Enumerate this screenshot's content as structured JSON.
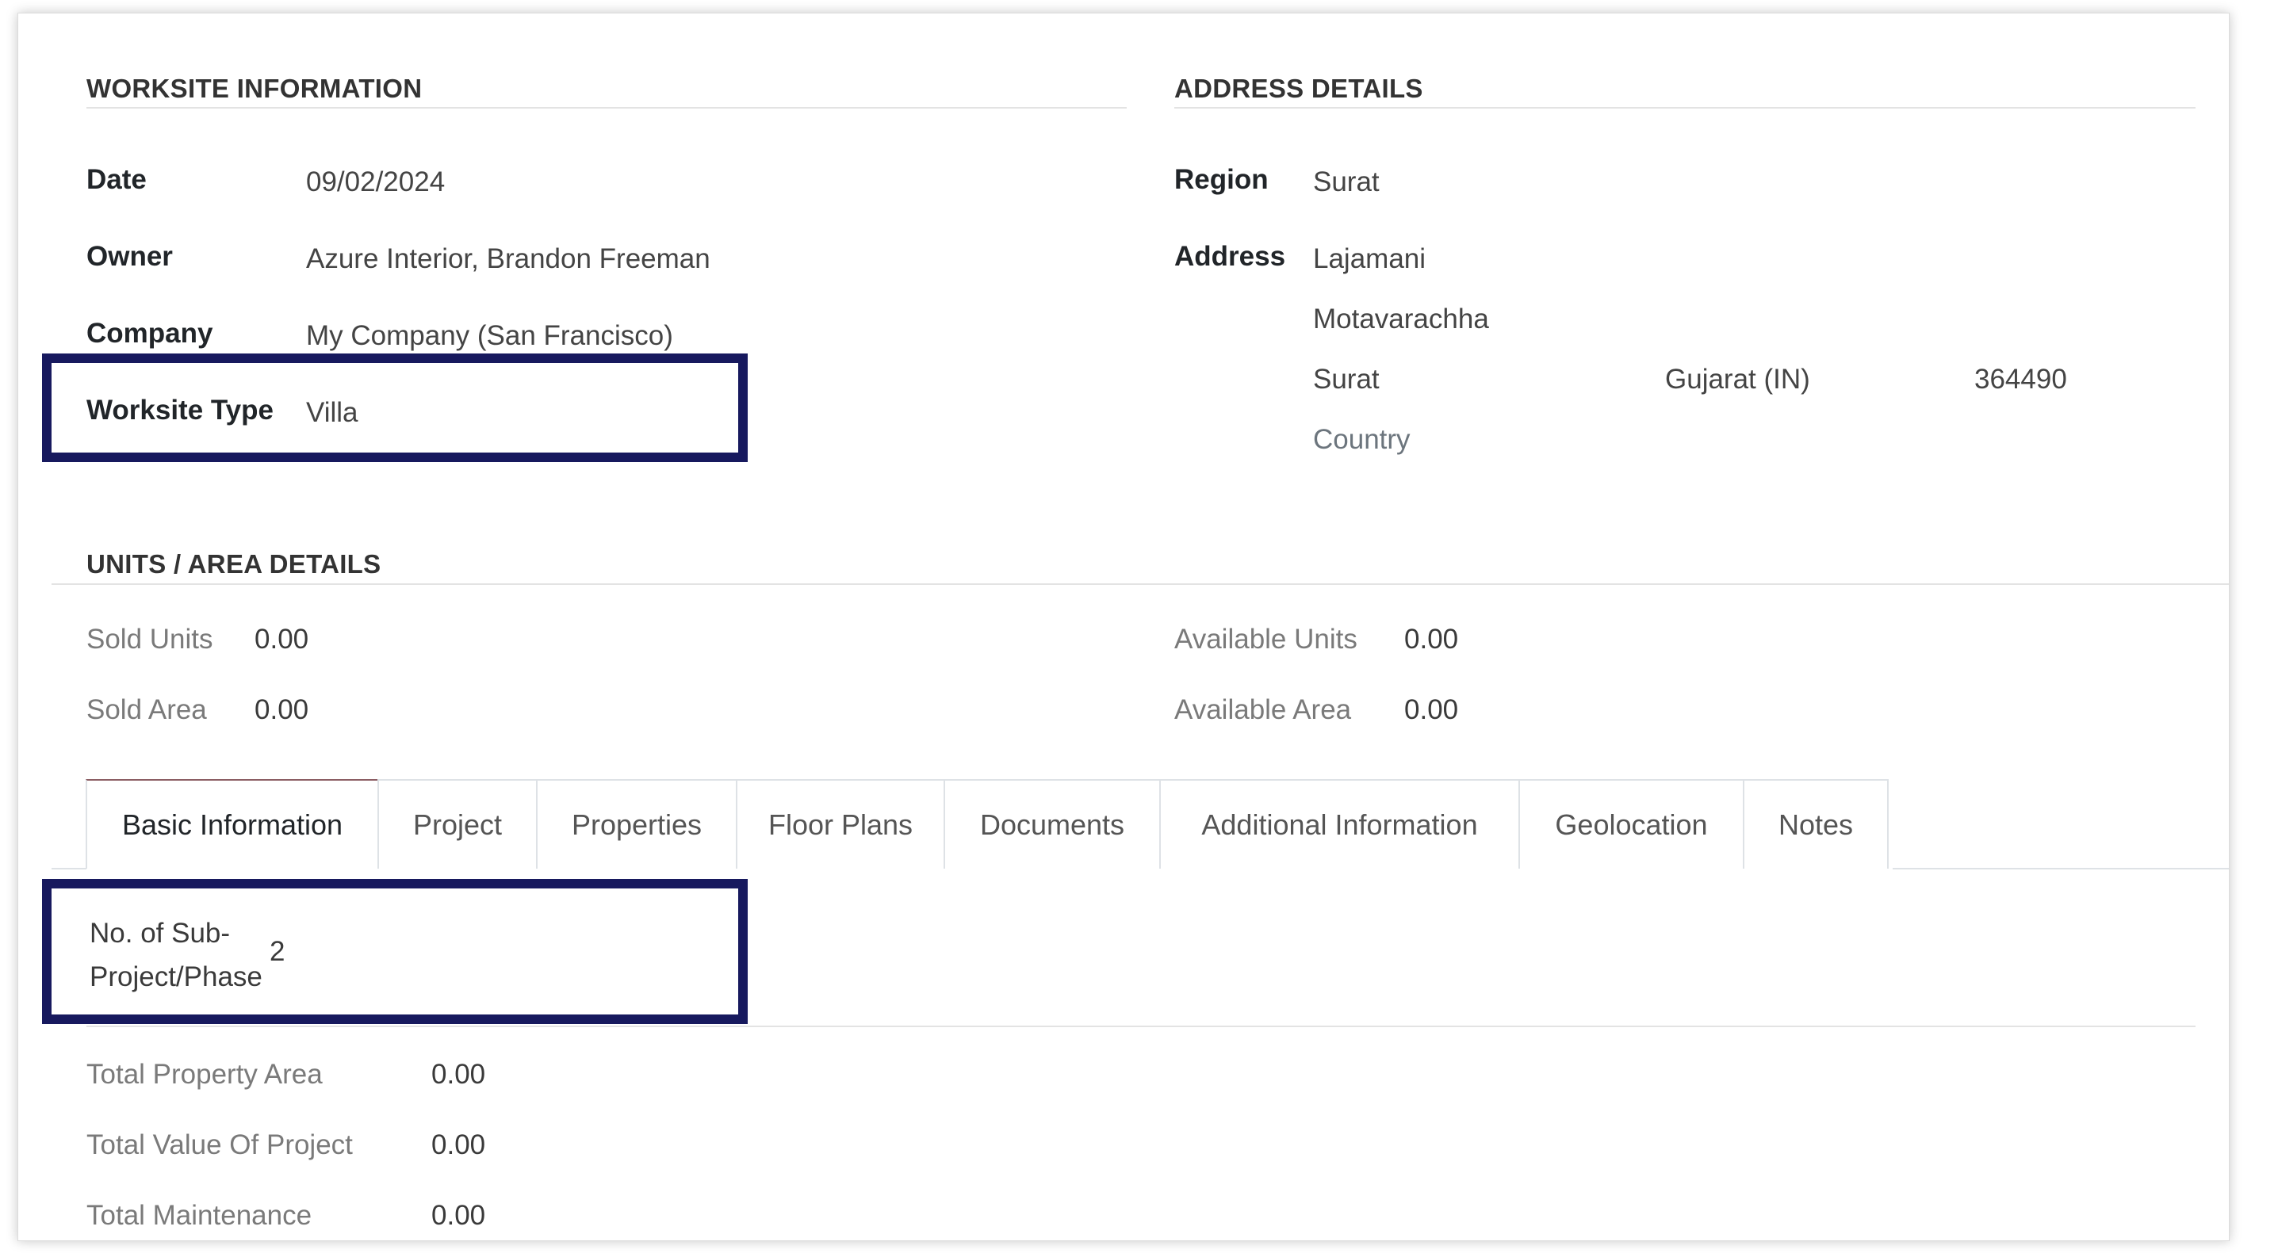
{
  "worksite": {
    "title": "WORKSITE INFORMATION",
    "date_label": "Date",
    "date": "09/02/2024",
    "owner_label": "Owner",
    "owner": "Azure Interior, Brandon Freeman",
    "company_label": "Company",
    "company": "My Company (San Francisco)",
    "type_label": "Worksite Type",
    "type": "Villa"
  },
  "address": {
    "title": "ADDRESS DETAILS",
    "region_label": "Region",
    "region": "Surat",
    "address_label": "Address",
    "street": "Lajamani",
    "street2": "Motavarachha",
    "city": "Surat",
    "state": "Gujarat (IN)",
    "zip": "364490",
    "country_placeholder": "Country"
  },
  "units": {
    "title": "UNITS / AREA DETAILS",
    "sold_units_label": "Sold Units",
    "sold_units": "0.00",
    "sold_area_label": "Sold Area",
    "sold_area": "0.00",
    "available_units_label": "Available Units",
    "available_units": "0.00",
    "available_area_label": "Available Area",
    "available_area": "0.00"
  },
  "tabs": [
    {
      "label": "Basic Information",
      "active": true
    },
    {
      "label": "Project"
    },
    {
      "label": "Properties"
    },
    {
      "label": "Floor Plans"
    },
    {
      "label": "Documents"
    },
    {
      "label": "Additional Information"
    },
    {
      "label": "Geolocation"
    },
    {
      "label": "Notes"
    }
  ],
  "basic": {
    "subproject_label_line1": "No. of Sub-",
    "subproject_label_line2": "Project/Phase",
    "subproject_value": "2",
    "total_property_area_label": "Total Property Area",
    "total_property_area": "0.00",
    "total_value_label": "Total Value Of Project",
    "total_value": "0.00",
    "total_maintenance_label": "Total Maintenance",
    "total_maintenance": "0.00"
  },
  "colors": {
    "highlight": "#17195e",
    "active_tab_accent": "#8b5d63"
  }
}
